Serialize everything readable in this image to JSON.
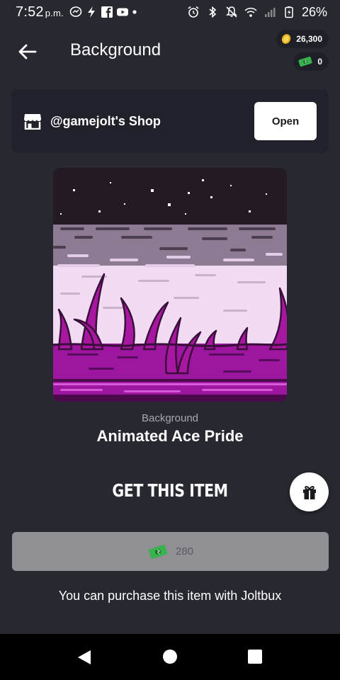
{
  "status_bar": {
    "time": "7:52",
    "ampm": "p.m.",
    "battery": "26%",
    "left_icons": [
      "messenger-icon",
      "bolt-icon",
      "facebook-icon",
      "youtube-icon",
      "dot-icon"
    ],
    "right_icons": [
      "alarm-icon",
      "bluetooth-icon",
      "mute-icon",
      "wifi-icon",
      "signal-icon",
      "battery-icon"
    ]
  },
  "header": {
    "title": "Background",
    "coins": "26,300",
    "joltbux": "0"
  },
  "shop": {
    "name": "@gamejolt's Shop",
    "open_label": "Open"
  },
  "item": {
    "type": "Background",
    "name": "Animated Ace Pride"
  },
  "purchase": {
    "heading": "GET THIS ITEM",
    "price": "280",
    "note": "You can purchase this item with Joltbux"
  },
  "colors": {
    "background": "#272830",
    "card": "#20212a",
    "buy_button": "#8f8f94",
    "art_black": "#231a24",
    "art_gray": "#8d7a93",
    "art_white": "#f1dcf3",
    "art_purple": "#9d169f"
  }
}
